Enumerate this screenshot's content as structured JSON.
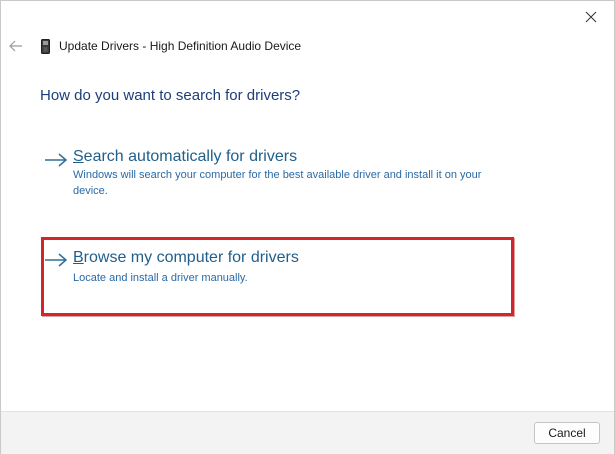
{
  "dialog": {
    "title": "Update Drivers - High Definition Audio Device",
    "question": "How do you want to search for drivers?"
  },
  "options": [
    {
      "title_first_letter": "S",
      "title_rest": "earch automatically for drivers",
      "description": "Windows will search your computer for the best available driver and install it on your device.",
      "icon": "arrow-right-icon"
    },
    {
      "title_first_letter": "B",
      "title_rest": "rowse my computer for drivers",
      "description": "Locate and install a driver manually.",
      "icon": "arrow-right-icon",
      "highlighted": true,
      "highlight_color": "#d0262c"
    }
  ],
  "footer": {
    "cancel_label": "Cancel"
  },
  "icons": {
    "close": "close-icon",
    "back": "back-arrow-icon",
    "device": "audio-device-icon"
  },
  "colors": {
    "link": "#1f5f8a",
    "question": "#1c3d7a",
    "highlight": "#d0262c"
  }
}
